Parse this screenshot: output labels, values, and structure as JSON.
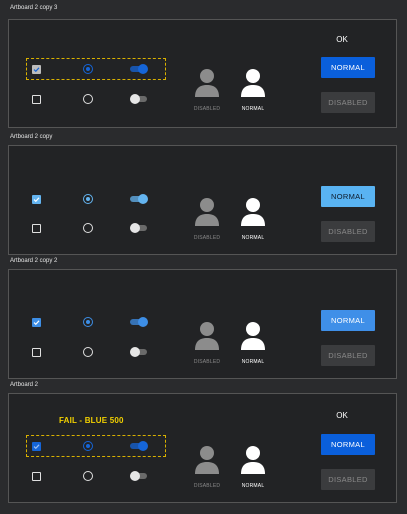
{
  "artboards": [
    {
      "title": "Artboard 2 copy 3",
      "ok_label": "OK",
      "fail_label": "",
      "accent": "#1565d8",
      "button_normal_color": "#0a5fdb",
      "button_normal_text": "NORMAL",
      "button_disabled_text": "DISABLED",
      "avatar_disabled_label": "DISABLED",
      "avatar_normal_label": "NORMAL"
    },
    {
      "title": "Artboard 2 copy",
      "ok_label": "",
      "fail_label": "",
      "accent": "#64b4f0",
      "button_normal_color": "#59b3f2",
      "button_normal_text": "NORMAL",
      "button_disabled_text": "DISABLED",
      "avatar_disabled_label": "DISABLED",
      "avatar_normal_label": "NORMAL"
    },
    {
      "title": "Artboard 2 copy 2",
      "ok_label": "",
      "fail_label": "",
      "accent": "#3d8ee6",
      "button_normal_color": "#3f8fe8",
      "button_normal_text": "NORMAL",
      "button_disabled_text": "DISABLED",
      "avatar_disabled_label": "DISABLED",
      "avatar_normal_label": "NORMAL"
    },
    {
      "title": "Artboard 2",
      "ok_label": "OK",
      "fail_label": "FAIL  - BLUE 500",
      "accent": "#1565d8",
      "button_normal_color": "#0a5fdb",
      "button_normal_text": "NORMAL",
      "button_disabled_text": "DISABLED",
      "avatar_disabled_label": "DISABLED",
      "avatar_normal_label": "NORMAL"
    }
  ],
  "colors": {
    "disabled_button_bg": "#3b3c3e",
    "disabled_button_text": "#8a8a8a",
    "avatar_disabled": "#8c8c8c",
    "avatar_normal": "#ffffff",
    "toggle_off_track": "#6a6a6a",
    "toggle_off_knob": "#e6e6e6",
    "highlight_border": "#d9b100"
  },
  "icons": {
    "avatar": "person-icon",
    "checkbox": "checkmark-icon"
  }
}
